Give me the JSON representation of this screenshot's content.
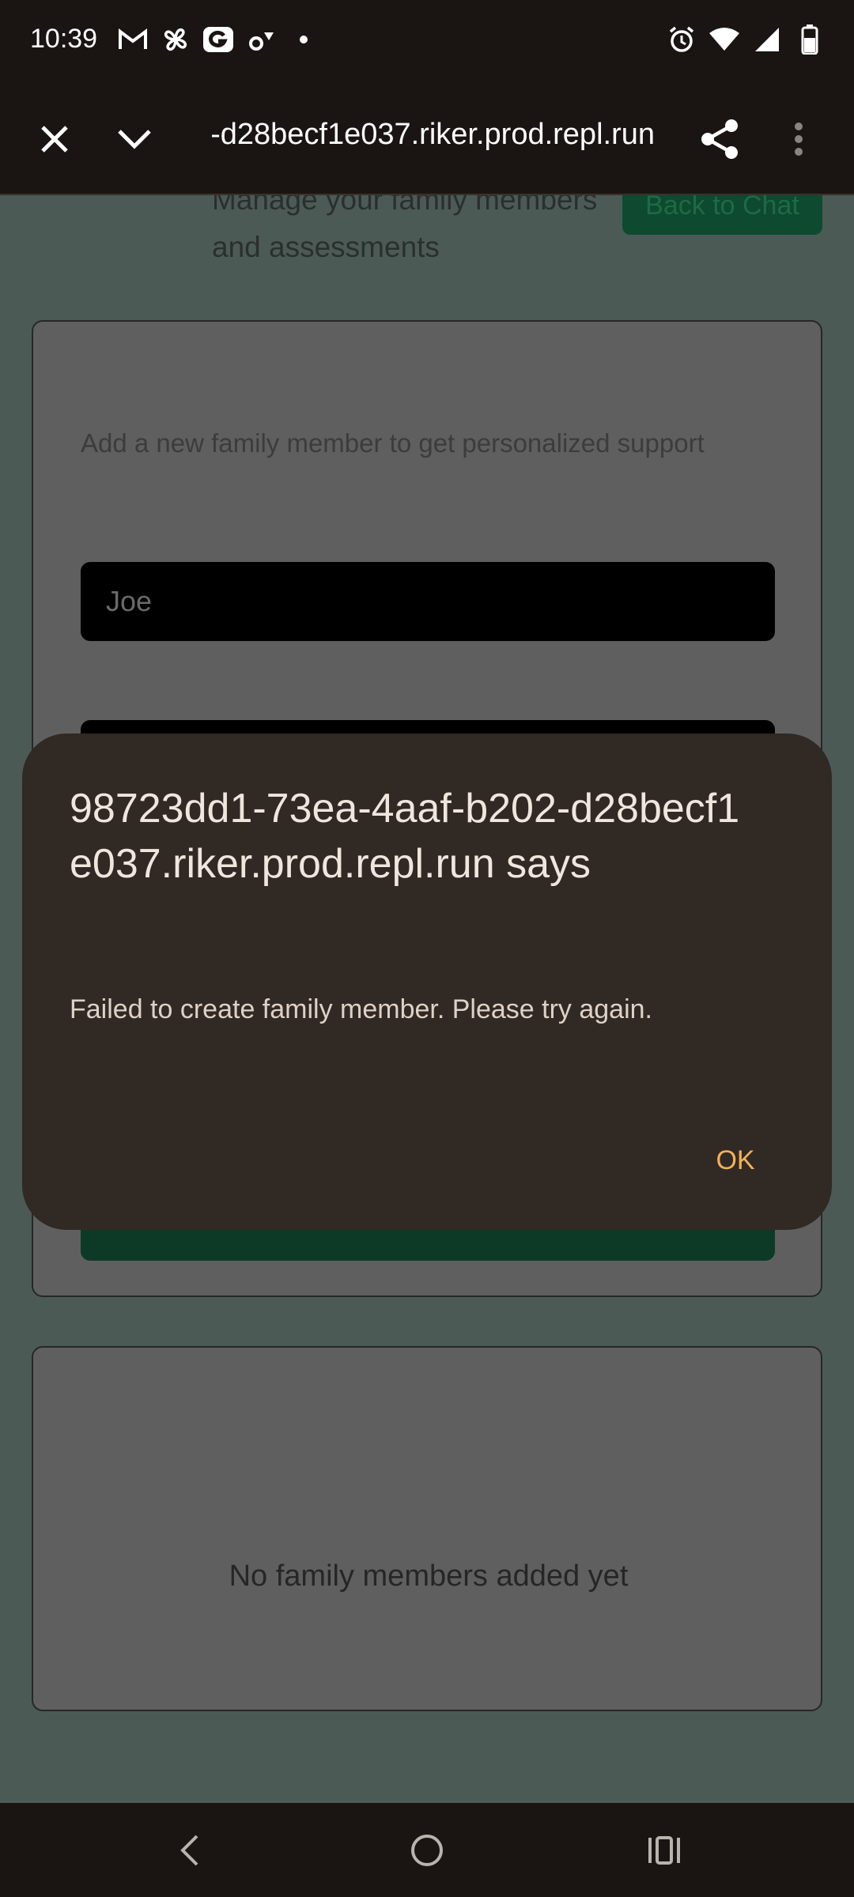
{
  "status_bar": {
    "time": "10:39",
    "left_icons": [
      "gmail-icon",
      "pinwheel-icon",
      "g-icon",
      "settings-wifi-icon",
      "dot-icon"
    ],
    "right_icons": [
      "alarm-icon",
      "wifi-icon",
      "signal-icon",
      "battery-icon"
    ]
  },
  "toolbar": {
    "url": "98723dd1-73ea-4aaf-b202-d28becf1e037.riker.prod.repl.run",
    "icons": [
      "close-icon",
      "chevron-down-icon",
      "share-icon",
      "more-vert-icon"
    ]
  },
  "page": {
    "header_subtitle": "Manage your family members and assessments",
    "back_to_chat_label": "Back to Chat",
    "form_description": "Add a new family member to get personalized support",
    "name_input_value": "Joe",
    "empty_state": "No family members added yet"
  },
  "dialog": {
    "title": "98723dd1-73ea-4aaf-b202-d28becf1e037.riker.prod.repl.run says",
    "message": "Failed to create family member. Please try again.",
    "ok_label": "OK"
  },
  "colors": {
    "dialog_bg": "#312924",
    "accent": "#f2b15b",
    "page_dim": "#4c5a56"
  }
}
